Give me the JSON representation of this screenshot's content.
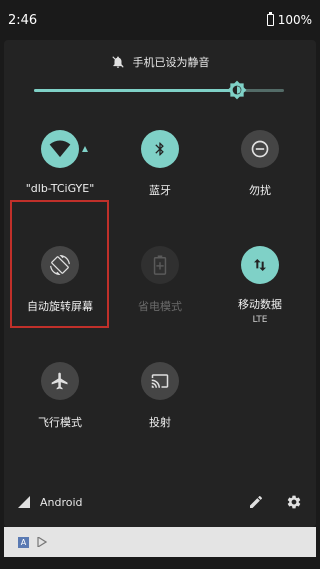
{
  "status_bar": {
    "time": "2:46",
    "battery": "100%"
  },
  "dnd": {
    "label": "手机已设为静音"
  },
  "brightness": {
    "level": 0.81
  },
  "tiles": [
    {
      "label": "\"dlb-TCiGYE\"",
      "icon": "wifi-icon",
      "state": "on",
      "sub": ""
    },
    {
      "label": "蓝牙",
      "icon": "bluetooth-icon",
      "state": "on",
      "sub": ""
    },
    {
      "label": "勿扰",
      "icon": "dnd-icon",
      "state": "off",
      "sub": ""
    },
    {
      "label": "自动旋转屏幕",
      "icon": "rotate-icon",
      "state": "off",
      "sub": ""
    },
    {
      "label": "省电模式",
      "icon": "battery-saver-icon",
      "state": "unavailable",
      "sub": ""
    },
    {
      "label": "移动数据",
      "icon": "mobile-data-icon",
      "state": "on",
      "sub": "LTE"
    },
    {
      "label": "飞行模式",
      "icon": "airplane-icon",
      "state": "off",
      "sub": ""
    },
    {
      "label": "投射",
      "icon": "cast-icon",
      "state": "off",
      "sub": ""
    }
  ],
  "bottom": {
    "carrier": "Android"
  },
  "nav_strip": {
    "badge": "A"
  },
  "colors": {
    "accent": "#7fd1c7",
    "panel": "#232323",
    "tile_off": "#454545",
    "highlight": "#c0302a"
  }
}
